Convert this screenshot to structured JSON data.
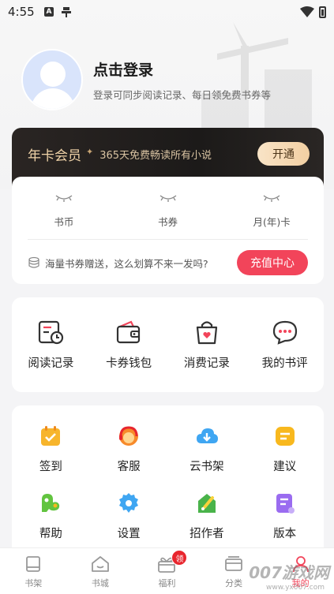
{
  "status_bar": {
    "time": "4:55",
    "a_badge": "A",
    "icons": [
      "notification-icon",
      "wifi-icon",
      "battery-icon"
    ]
  },
  "profile": {
    "title": "点击登录",
    "subtitle": "登录可同步阅读记录、每日领免费书券等"
  },
  "vip": {
    "title": "年卡会员",
    "subtitle": "365天免费畅读所有小说",
    "button": "开通",
    "colors": {
      "bg": "#1f1c1b",
      "gold": "#f0d3a8"
    }
  },
  "assets": {
    "items": [
      {
        "label": "书币"
      },
      {
        "label": "书券"
      },
      {
        "label": "月(年)卡"
      }
    ],
    "promo_text": "海量书券赠送，这么划算不来一发吗?",
    "recharge_button": "充值中心",
    "accent": "#f2445a"
  },
  "quick_actions": [
    {
      "label": "阅读记录",
      "icon": "reading-record-icon"
    },
    {
      "label": "卡券钱包",
      "icon": "wallet-icon"
    },
    {
      "label": "消费记录",
      "icon": "shopping-bag-icon"
    },
    {
      "label": "我的书评",
      "icon": "comment-icon"
    }
  ],
  "tools": {
    "row1": [
      {
        "label": "签到",
        "icon": "checkin-icon"
      },
      {
        "label": "客服",
        "icon": "customer-service-icon"
      },
      {
        "label": "云书架",
        "icon": "cloud-download-icon"
      },
      {
        "label": "建议",
        "icon": "suggestion-icon"
      }
    ],
    "row2": [
      {
        "label": "帮助",
        "icon": "help-icon"
      },
      {
        "label": "设置",
        "icon": "settings-gear-icon"
      },
      {
        "label": "招作者",
        "icon": "recruit-author-icon"
      },
      {
        "label": "版本",
        "icon": "version-icon"
      }
    ]
  },
  "bottom_nav": {
    "items": [
      {
        "label": "书架",
        "icon": "bookshelf-icon"
      },
      {
        "label": "书城",
        "icon": "bookstore-icon"
      },
      {
        "label": "福利",
        "icon": "gift-icon",
        "badge": "领"
      },
      {
        "label": "分类",
        "icon": "category-icon"
      },
      {
        "label": "我的",
        "icon": "profile-icon"
      }
    ],
    "active": "我的"
  },
  "watermark": {
    "text": "007游戏网",
    "sub": "www.yx007.com"
  }
}
